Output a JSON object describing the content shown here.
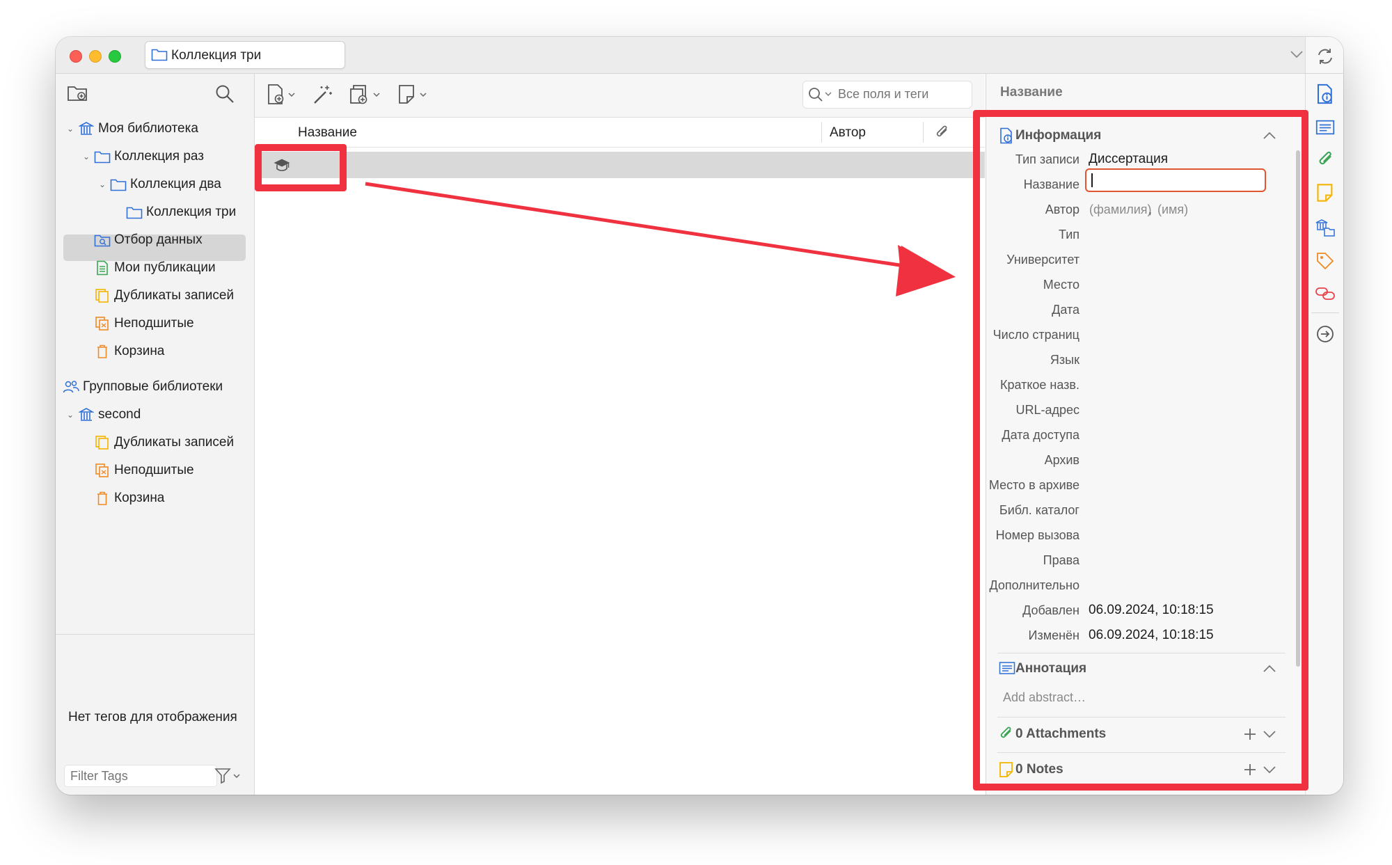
{
  "titlebar": {
    "tab_label": "Коллекция три"
  },
  "library_tree": {
    "my_library": "Моя библиотека",
    "collection_one": "Коллекция раз",
    "collection_two": "Коллекция два",
    "collection_three": "Коллекция три",
    "saved_search": "Отбор данных",
    "my_publications": "Мои публикации",
    "duplicates": "Дубликаты записей",
    "unfiled": "Неподшитые",
    "trash": "Корзина",
    "group_libraries": "Групповые библиотеки",
    "group_name": "second",
    "group_duplicates": "Дубликаты записей",
    "group_unfiled": "Неподшитые",
    "group_trash": "Корзина"
  },
  "tags": {
    "empty_message": "Нет тегов для отображения",
    "filter_placeholder": "Filter Tags"
  },
  "items": {
    "search_placeholder": "Все поля и теги",
    "col_title": "Название",
    "col_author": "Автор"
  },
  "item_pane": {
    "header_title": "Название",
    "info_section": "Информация",
    "fields": [
      {
        "label": "Тип записи",
        "value": "Диссертация"
      },
      {
        "label": "Название",
        "value": ""
      },
      {
        "label": "Автор",
        "value": ""
      },
      {
        "label": "Тип",
        "value": ""
      },
      {
        "label": "Университет",
        "value": ""
      },
      {
        "label": "Место",
        "value": ""
      },
      {
        "label": "Дата",
        "value": ""
      },
      {
        "label": "Число страниц",
        "value": ""
      },
      {
        "label": "Язык",
        "value": ""
      },
      {
        "label": "Краткое назв.",
        "value": ""
      },
      {
        "label": "URL-адрес",
        "value": ""
      },
      {
        "label": "Дата доступа",
        "value": ""
      },
      {
        "label": "Архив",
        "value": ""
      },
      {
        "label": "Место в архиве",
        "value": ""
      },
      {
        "label": "Библ. каталог",
        "value": ""
      },
      {
        "label": "Номер вызова",
        "value": ""
      },
      {
        "label": "Права",
        "value": ""
      },
      {
        "label": "Дополнительно",
        "value": ""
      },
      {
        "label": "Добавлен",
        "value": "06.09.2024, 10:18:15"
      },
      {
        "label": "Изменён",
        "value": "06.09.2024, 10:18:15"
      }
    ],
    "author_last_placeholder": "(фамилия)",
    "author_separator": ",",
    "author_first_placeholder": "(имя)",
    "abstract_section": "Аннотация",
    "abstract_placeholder": "Add abstract…",
    "attachments_section": "0 Attachments",
    "notes_section": "0 Notes"
  },
  "colors": {
    "annotation_red": "#f0313f",
    "accent_blue": "#2e6fd8",
    "attachment_green": "#3aa655",
    "note_yellow": "#f5b400",
    "tag_orange": "#f08a24",
    "field_focus": "#e2562f"
  }
}
